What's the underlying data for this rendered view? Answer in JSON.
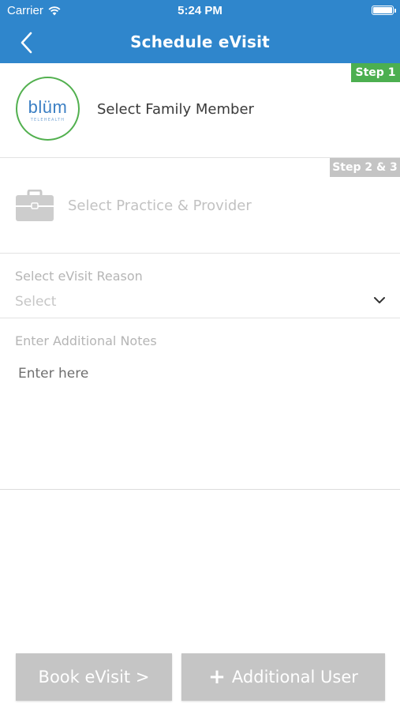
{
  "status_bar": {
    "carrier": "Carrier",
    "time": "5:24 PM",
    "wifi_icon": "wifi-icon",
    "battery_level": 1.0
  },
  "nav": {
    "title": "Schedule eVisit",
    "back_icon": "chevron-left-icon"
  },
  "colors": {
    "primary": "#2f86cc",
    "step_active": "#4caf50",
    "step_inactive": "#c4c4c4",
    "button": "#c5c5c5"
  },
  "step1": {
    "badge": "Step 1",
    "logo_text": "blüm",
    "logo_sub": "TELEHEALTH",
    "label": "Select Family Member"
  },
  "step23": {
    "badge": "Step 2 & 3",
    "icon": "briefcase-icon",
    "label": "Select Practice & Provider"
  },
  "reason": {
    "label": "Select eVisit Reason",
    "value": "Select",
    "icon": "chevron-down-icon"
  },
  "notes": {
    "label": "Enter Additional Notes",
    "placeholder": "Enter here"
  },
  "buttons": {
    "book": "Book eVisit >",
    "add_plus": "+",
    "add": "Additional User"
  }
}
